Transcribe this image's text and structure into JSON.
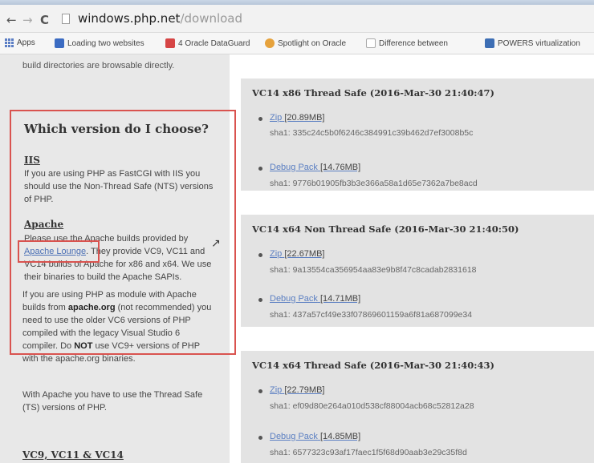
{
  "browser": {
    "url_host": "windows.php.net",
    "url_path": "/download",
    "bookmarks": [
      {
        "label": "Apps",
        "color": "#5a7dc4"
      },
      {
        "label": "Loading two websites",
        "color": "#3b6bc2"
      },
      {
        "label": "4 Oracle DataGuard",
        "color": "#d64545"
      },
      {
        "label": "Spotlight on Oracle",
        "color": "#e6a23c"
      },
      {
        "label": "Difference between",
        "color": "#cccccc"
      },
      {
        "label": "POWERS virtualization",
        "color": "#3d6eb4"
      }
    ]
  },
  "sidebar": {
    "intro": "build directories are browsable directly.",
    "choose_title": "Which version do I choose?",
    "iis_heading": "IIS",
    "iis_text": "If you are using PHP as FastCGI with IIS you should use the Non-Thread Safe (NTS) versions of PHP.",
    "apache_heading": "Apache",
    "apache_pre": "Please use the Apache builds provided by ",
    "apache_link": "Apache Lounge",
    "apache_post": ". They provide VC9, VC11 and VC14 builds of Apache for x86 and x64. We use their binaries to build the Apache SAPIs.",
    "module_pre": "If you are using PHP as module with Apache builds from ",
    "module_bold1": "apache.org",
    "module_mid": " (not recommended) you need to use the older VC6 versions of PHP compiled with the legacy Visual Studio 6 compiler. Do ",
    "module_bold2": "NOT",
    "module_post": " use VC9+ versions of PHP with the apache.org binaries.",
    "ts_text": "With Apache you have to use the Thread Safe (TS) versions of PHP.",
    "vc_heading": "VC9, VC11 & VC14"
  },
  "downloads": [
    {
      "title": "VC14 x86 Thread Safe (2016-Mar-30 21:40:47)",
      "zip_label": "Zip",
      "zip_size": "[20.89MB]",
      "zip_sha": "sha1: 335c24c5b0f6246c384991c39b462d7ef3008b5c",
      "debug_label": "Debug Pack",
      "debug_size": "[14.76MB]",
      "debug_sha": "sha1: 9776b01905fb3b3e366a58a1d65e7362a7be8acd"
    },
    {
      "title": "VC14 x64 Non Thread Safe (2016-Mar-30 21:40:50)",
      "zip_label": "Zip",
      "zip_size": "[22.67MB]",
      "zip_sha": "sha1: 9a13554ca356954aa83e9b8f47c8cadab2831618",
      "debug_label": "Debug Pack",
      "debug_size": "[14.71MB]",
      "debug_sha": "sha1: 437a57cf49e33f07869601159a6f81a687099e34"
    },
    {
      "title": "VC14 x64 Thread Safe (2016-Mar-30 21:40:43)",
      "zip_label": "Zip",
      "zip_size": "[22.79MB]",
      "zip_sha": "sha1: ef09d80e264a010d538cf88004acb68c52812a28",
      "debug_label": "Debug Pack",
      "debug_size": "[14.85MB]",
      "debug_sha": "sha1: 6577323c93af17faec1f5f68d90aab3e29c35f8d"
    }
  ]
}
